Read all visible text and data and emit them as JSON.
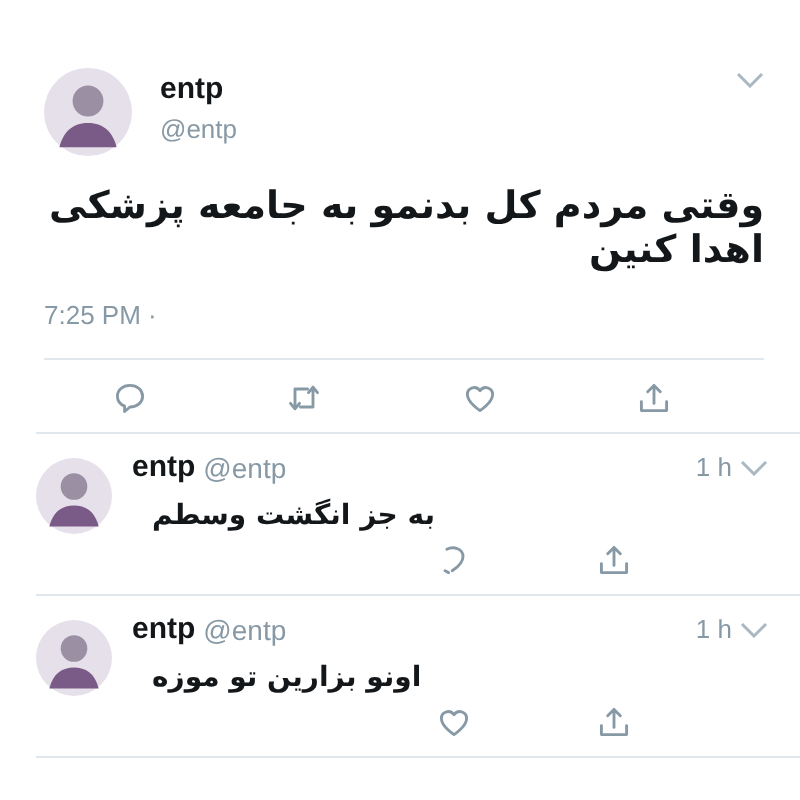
{
  "tweet": {
    "name": "entp",
    "handle": "@entp",
    "text": "وقتی مردم کل بدنمو به جامعه پزشکی اهدا کنین",
    "time": "7:25 PM ·",
    "actions": [
      {
        "kind": "reply"
      },
      {
        "kind": "retweet"
      },
      {
        "kind": "like"
      },
      {
        "kind": "share"
      }
    ]
  },
  "replies": [
    {
      "name": "entp",
      "handle": "@entp",
      "age": "1 h",
      "text": "به جز انگشت وسطم",
      "actions": [
        {
          "kind": "curve"
        },
        {
          "kind": "share"
        }
      ]
    },
    {
      "name": "entp",
      "handle": "@entp",
      "age": "1 h",
      "text": "اونو بزارین تو موزه",
      "actions": [
        {
          "kind": "like"
        },
        {
          "kind": "share"
        }
      ]
    }
  ]
}
